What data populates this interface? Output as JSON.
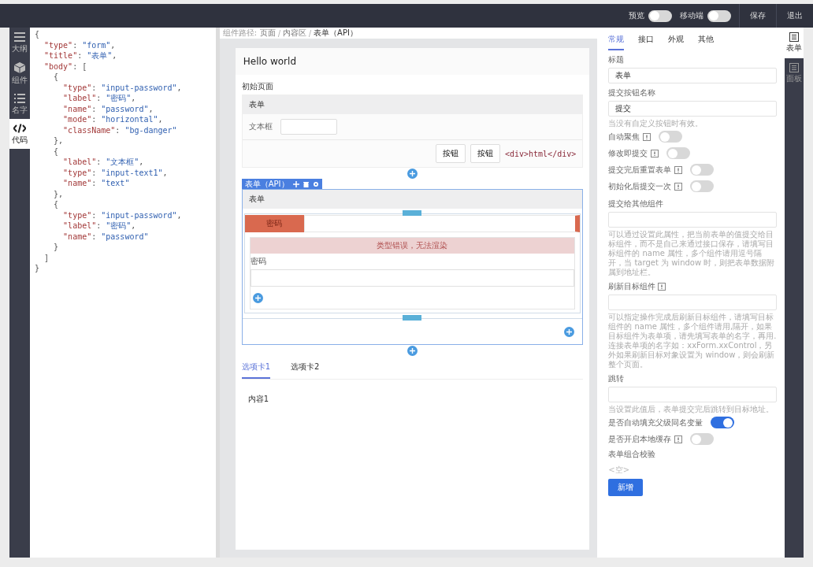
{
  "top_bar": {
    "toggles": [
      {
        "label": "预览",
        "on": false
      },
      {
        "label": "移动端",
        "on": false
      }
    ],
    "buttons": [
      "保存",
      "退出"
    ]
  },
  "left_rail": [
    {
      "label": "大纲",
      "kind": "menu",
      "selected": false
    },
    {
      "label": "组件",
      "kind": "cube",
      "selected": false
    },
    {
      "label": "名字",
      "kind": "list",
      "selected": false
    },
    {
      "label": "代码",
      "kind": "code",
      "selected": true
    }
  ],
  "code_editor": {
    "lines": [
      "{",
      "  \"type\": \"form\",",
      "  \"title\": \"表单\",",
      "  \"body\": [",
      "    {",
      "      \"type\": \"input-password\",",
      "      \"label\": \"密码\",",
      "      \"name\": \"password\",",
      "      \"mode\": \"horizontal\",",
      "      \"className\": \"bg-danger\"",
      "    },",
      "    {",
      "      \"label\": \"文本框\",",
      "      \"type\": \"input-text1\",",
      "      \"name\": \"text\"",
      "    },",
      "    {",
      "      \"type\": \"input-password\",",
      "      \"label\": \"密码\",",
      "      \"name\": \"password\"",
      "    }",
      "  ]",
      "}"
    ]
  },
  "breadcrumb": {
    "label": "组件路径:",
    "items": [
      "页面",
      "内容区",
      "表单（API）"
    ]
  },
  "canvas": {
    "page_title": "Hello world",
    "section_label": "初始页面",
    "form": {
      "title": "表单",
      "field_label": "文本框",
      "buttons": [
        "按钮",
        "按钮"
      ],
      "html": "<div>html</div>"
    },
    "selected_form": {
      "tag": "表单（API）",
      "title": "表单",
      "danger_label": "密码",
      "error": "类型错误，无法渲染",
      "field_label": "密码"
    },
    "tabs": [
      {
        "label": "选项卡1",
        "selected": true
      },
      {
        "label": "选项卡2",
        "selected": false
      }
    ],
    "tab_content": "内容1"
  },
  "props_panel": {
    "tabs": [
      {
        "label": "常规",
        "selected": true
      },
      {
        "label": "接口",
        "selected": false
      },
      {
        "label": "外观",
        "selected": false
      },
      {
        "label": "其他",
        "selected": false
      }
    ],
    "items": [
      {
        "kind": "input",
        "label": "标题",
        "value": "表单"
      },
      {
        "kind": "input",
        "label": "提交按钮名称",
        "value": "提交",
        "hint": "当没有自定义按钮时有效。"
      },
      {
        "kind": "switch",
        "label": "自动聚焦",
        "info": true,
        "on": false
      },
      {
        "kind": "switch",
        "label": "修改即提交",
        "info": true,
        "on": false
      },
      {
        "kind": "switch",
        "label": "提交完后重置表单",
        "info": true,
        "on": false
      },
      {
        "kind": "switch",
        "label": "初始化后提交一次",
        "info": true,
        "on": false
      },
      {
        "kind": "input",
        "label": "提交给其他组件",
        "hint": "可以通过设置此属性，把当前表单的值提交给目标组件，而不是自己来通过接口保存，请填写目标组件的 name 属性，多个组件请用逗号隔开，当 target 为 window 时，则把表单数据附属到地址栏。"
      },
      {
        "kind": "input",
        "label": "刷新目标组件",
        "info": true,
        "hint": "可以指定操作完成后刷新目标组件，请填写目标组件的 name 属性，多个组件请用,隔开，如果目标组件为表单项，请先填写表单的名字，再用.连接表单项的名字如：xxForm.xxControl，另外如果刷新目标对象设置为 window，则会刷新整个页面。"
      },
      {
        "kind": "input",
        "label": "跳转",
        "hint": "当设置此值后，表单提交完后跳转到目标地址。"
      },
      {
        "kind": "switch",
        "label": "是否自动填充父级同名变量",
        "on": true
      },
      {
        "kind": "switch",
        "label": "是否开启本地缓存",
        "info": true,
        "on": false
      },
      {
        "kind": "heading",
        "label": "表单组合校验"
      }
    ],
    "empty": "<空>",
    "add_button": "新增"
  },
  "right_rail": [
    {
      "label": "表单",
      "selected": true
    },
    {
      "label": "面板",
      "selected": false
    }
  ]
}
